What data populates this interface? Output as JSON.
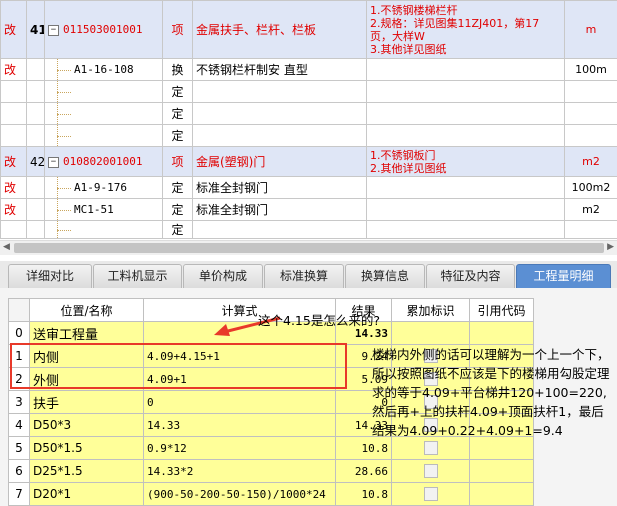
{
  "top_rows": [
    {
      "mark": "改",
      "num": "41",
      "code": "011503001001",
      "type": "项",
      "name": "金属扶手、栏杆、栏板",
      "desc": [
        "1.不锈钢楼梯栏杆",
        "2.规格：详见图集11ZJ401，第17页，大样W",
        "3.其他详见图纸"
      ],
      "unit": "m",
      "highlight": true,
      "level": 0
    },
    {
      "mark": "改",
      "num": "",
      "code": "A1-16-108",
      "type": "换",
      "name": "不锈钢栏杆制安 直型",
      "desc": [],
      "unit": "100m",
      "highlight": false,
      "level": 1
    },
    {
      "mark": "",
      "num": "",
      "code": "",
      "type": "定",
      "name": "",
      "desc": [],
      "unit": "",
      "highlight": false,
      "level": 1
    },
    {
      "mark": "",
      "num": "",
      "code": "",
      "type": "定",
      "name": "",
      "desc": [],
      "unit": "",
      "highlight": false,
      "level": 1
    },
    {
      "mark": "",
      "num": "",
      "code": "",
      "type": "定",
      "name": "",
      "desc": [],
      "unit": "",
      "highlight": false,
      "level": 1
    },
    {
      "mark": "改",
      "num": "42",
      "code": "010802001001",
      "type": "项",
      "name": "金属(塑钢)门",
      "desc": [
        "1.不锈钢板门",
        "2.其他详见图纸"
      ],
      "unit": "m2",
      "highlight": true,
      "level": 0
    },
    {
      "mark": "改",
      "num": "",
      "code": "A1-9-176",
      "type": "定",
      "name": "标准全封钢门",
      "desc": [],
      "unit": "100m2",
      "highlight": false,
      "level": 1
    },
    {
      "mark": "改",
      "num": "",
      "code": "MC1-51",
      "type": "定",
      "name": "标准全封钢门",
      "desc": [],
      "unit": "m2",
      "highlight": false,
      "level": 1
    },
    {
      "mark": "",
      "num": "",
      "code": "",
      "type": "定",
      "name": "",
      "desc": [],
      "unit": "",
      "highlight": false,
      "level": 1
    }
  ],
  "tabs": [
    "详细对比",
    "工料机显示",
    "单价构成",
    "标准换算",
    "换算信息",
    "特征及内容",
    "工程量明细"
  ],
  "active_tab": 6,
  "detail": {
    "headers": [
      "",
      "位置/名称",
      "计算式",
      "结果",
      "累加标识",
      "引用代码"
    ],
    "rows": [
      {
        "no": "0",
        "name": "送审工程量",
        "formula": "",
        "result": "14.33",
        "check": false
      },
      {
        "no": "1",
        "name": "内侧",
        "formula": "4.09+4.15+1",
        "result": "9.24",
        "check": true
      },
      {
        "no": "2",
        "name": "外侧",
        "formula": "4.09+1",
        "result": "5.09",
        "check": true
      },
      {
        "no": "3",
        "name": "扶手",
        "formula": "0",
        "result": "0",
        "check": true
      },
      {
        "no": "4",
        "name": "D50*3",
        "formula": "14.33",
        "result": "14.33",
        "check": true
      },
      {
        "no": "5",
        "name": "D50*1.5",
        "formula": "0.9*12",
        "result": "10.8",
        "check": true
      },
      {
        "no": "6",
        "name": "D25*1.5",
        "formula": "14.33*2",
        "result": "28.66",
        "check": true
      },
      {
        "no": "7",
        "name": "D20*1",
        "formula": "(900-50-200-50-150)/1000*24",
        "result": "10.8",
        "check": true
      }
    ]
  },
  "annotation": {
    "question": "这个4.15是怎么来的?",
    "comment": [
      "楼梯内外侧的话可以理解为一个上一个下，所以按照图纸不应该是下的楼梯用勾股定理求的等于4.09+平台梯井120+100=220,然后再+上的扶杆4.09+顶面扶杆1，最后结果为4.09+0.22+4.09+1=9.4"
    ]
  },
  "colors": {
    "highlight_row": "#dfe6f6",
    "formula_cell": "#ffff99",
    "active_tab": "#5b8fd3",
    "annotation_red": "#e8392a"
  }
}
